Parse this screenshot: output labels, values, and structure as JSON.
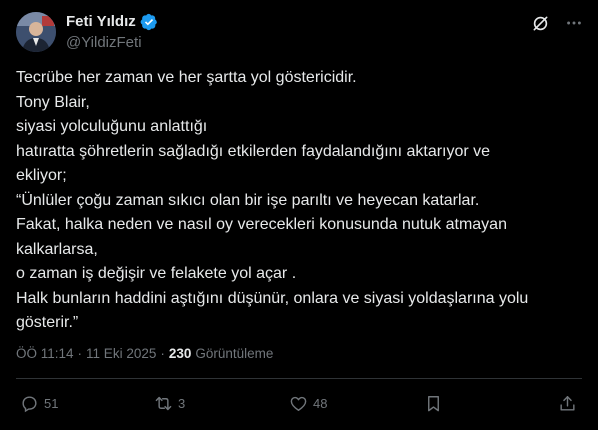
{
  "author": {
    "name": "Feti Yıldız",
    "handle": "@YildizFeti"
  },
  "post": {
    "lines": [
      "Tecrübe her zaman ve her şartta yol göstericidir.",
      "Tony Blair,",
      "siyasi yolculuğunu anlattığı",
      "hatıratta şöhretlerin sağladığı etkilerden faydalandığını aktarıyor ve",
      "ekliyor;",
      "“Ünlüler çoğu zaman sıkıcı olan bir işe parıltı ve heyecan katarlar.",
      "Fakat, halka neden ve nasıl oy verecekleri konusunda nutuk atmayan",
      "kalkarlarsa,",
      "o zaman iş değişir ve felakete yol açar .",
      "Halk bunların haddini aştığını düşünür, onlara ve siyasi yoldaşlarına yolu",
      "gösterir.”"
    ]
  },
  "meta": {
    "time": "ÖÖ 11:14",
    "separator": "·",
    "date": "11 Eki 2025",
    "views_count": "230",
    "views_label": "Görüntüleme"
  },
  "actions": {
    "replies": "51",
    "reposts": "3",
    "likes": "48"
  },
  "icons": {
    "verified": "verified-badge-icon",
    "grok": "grok-icon",
    "more": "more-icon",
    "reply": "reply-icon",
    "repost": "repost-icon",
    "like": "like-icon",
    "bookmark": "bookmark-icon",
    "share": "share-icon"
  },
  "colors": {
    "background": "#000000",
    "text": "#e7e9ea",
    "muted": "#71767b",
    "verified": "#1d9bf0",
    "divider": "#2f3336"
  }
}
